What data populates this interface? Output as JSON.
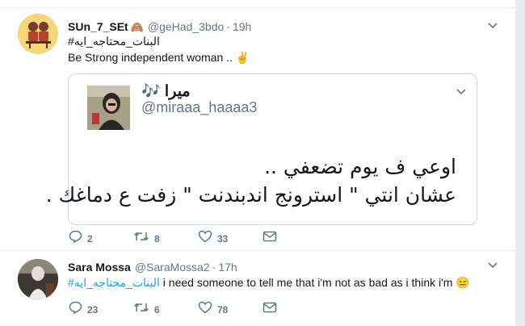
{
  "tweets": [
    {
      "display_name": "SUn_7_SEt",
      "name_emoji": "🙈",
      "handle": "@geHad_3bdo",
      "separator": "·",
      "time": "19h",
      "hashtag": "#البنات_محتاجه_ايه",
      "body": "Be Strong independent woman .. ✌",
      "quote": {
        "name": "ميرا 🎶",
        "handle": "@miraaa_haaaa3",
        "line1": "اوعي ف يوم تضعفي ..",
        "line2": "عشان انتي \" استرونج اندبندنت \" زفت ع دماغك ."
      },
      "replies": "2",
      "retweets": "8",
      "likes": "33"
    },
    {
      "display_name": "Sara Mossa",
      "handle": "@SaraMossa2",
      "separator": "·",
      "time": "17h",
      "hashtag": "#البنات_محتاجه_ايه",
      "body": " i need someone to tell me that i'm not as bad as i think i'm 😑",
      "replies": "23",
      "retweets": "6",
      "likes": "78"
    }
  ],
  "icons": {
    "chevron": "chevron-down-icon",
    "reply": "reply-icon",
    "retweet": "retweet-icon",
    "like": "heart-icon",
    "message": "envelope-icon"
  },
  "colors": {
    "link": "#1da1f2",
    "secondary": "#657786",
    "border": "#e6ecf0"
  }
}
